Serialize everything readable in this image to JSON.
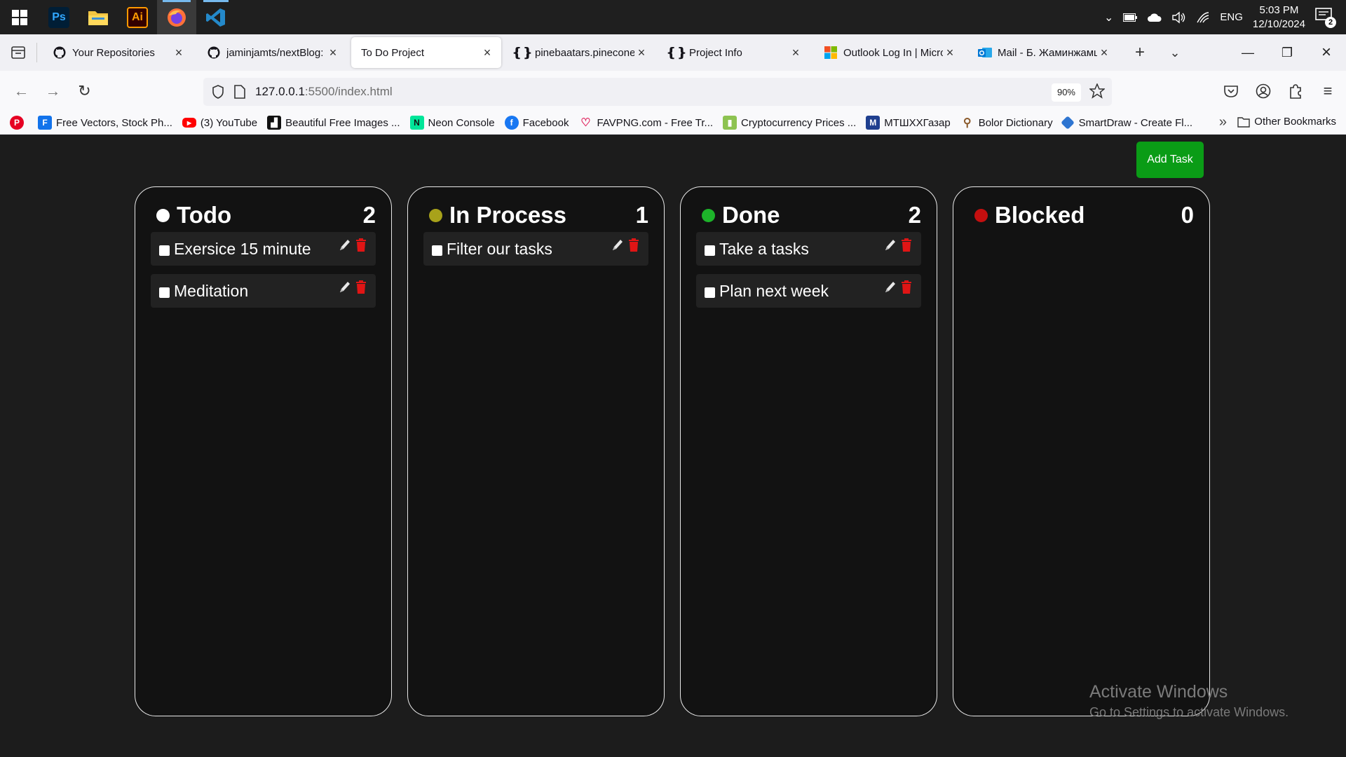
{
  "taskbar": {
    "apps": [
      {
        "name": "Photoshop",
        "label": "Ps"
      },
      {
        "name": "File Explorer",
        "label": ""
      },
      {
        "name": "Illustrator",
        "label": "Ai"
      },
      {
        "name": "Firefox",
        "label": ""
      },
      {
        "name": "VS Code",
        "label": ""
      }
    ],
    "tray": {
      "language": "ENG",
      "time": "5:03 PM",
      "date": "12/10/2024",
      "notifications": "2"
    }
  },
  "browser": {
    "tabs": [
      {
        "title": "Your Repositories",
        "icon": "github-icon",
        "active": false
      },
      {
        "title": "jaminjamts/nextBlog:",
        "icon": "github-icon",
        "active": false
      },
      {
        "title": "To Do Project",
        "icon": "",
        "active": true
      },
      {
        "title": "pinebaatars.pinecone.",
        "icon": "braces-icon",
        "active": false
      },
      {
        "title": "Project Info",
        "icon": "braces-icon",
        "active": false
      },
      {
        "title": "Outlook Log In | Micro",
        "icon": "microsoft-icon",
        "active": false
      },
      {
        "title": "Mail - Б. Жаминжамц",
        "icon": "outlook-icon",
        "active": false
      }
    ],
    "url_host": "127.0.0.1",
    "url_rest": ":5500/index.html",
    "zoom": "90%",
    "bookmarks": [
      {
        "label": "",
        "icon": "pinterest-icon",
        "color": "#e60023"
      },
      {
        "label": "Free Vectors, Stock Ph...",
        "icon": "freepik-icon",
        "color": "#1273eb"
      },
      {
        "label": "(3) YouTube",
        "icon": "youtube-icon",
        "color": "#ff0000"
      },
      {
        "label": "Beautiful Free Images ...",
        "icon": "unsplash-icon",
        "color": "#111111"
      },
      {
        "label": "Neon Console",
        "icon": "neon-icon",
        "color": "#00e599"
      },
      {
        "label": "Facebook",
        "icon": "facebook-icon",
        "color": "#1877f2"
      },
      {
        "label": "FAVPNG.com - Free Tr...",
        "icon": "favpng-icon",
        "color": "#e0245e"
      },
      {
        "label": "Cryptocurrency Prices ...",
        "icon": "coinmarketcap-icon",
        "color": "#8dc351"
      },
      {
        "label": "МТШХХГазар",
        "icon": "mtshhh-icon",
        "color": "#1f3f8f"
      },
      {
        "label": "Bolor Dictionary",
        "icon": "bolor-icon",
        "color": "#8b5a2b"
      },
      {
        "label": "SmartDraw - Create Fl...",
        "icon": "smartdraw-icon",
        "color": "#2e75d1"
      }
    ],
    "other_bookmarks": "Other Bookmarks"
  },
  "page": {
    "add_task_label": "Add Task",
    "columns": [
      {
        "title": "Todo",
        "count": "2",
        "dot_color": "#ffffff",
        "tasks": [
          "Exersice 15 minute",
          "Meditation"
        ]
      },
      {
        "title": "In Process",
        "count": "1",
        "dot_color": "#a8a21a",
        "tasks": [
          "Filter our tasks"
        ]
      },
      {
        "title": "Done",
        "count": "2",
        "dot_color": "#1db32a",
        "tasks": [
          "Take a tasks",
          "Plan next week"
        ]
      },
      {
        "title": "Blocked",
        "count": "0",
        "dot_color": "#c40f0f",
        "tasks": []
      }
    ]
  },
  "watermark": {
    "line1": "Activate Windows",
    "line2": "Go to Settings to activate Windows."
  }
}
